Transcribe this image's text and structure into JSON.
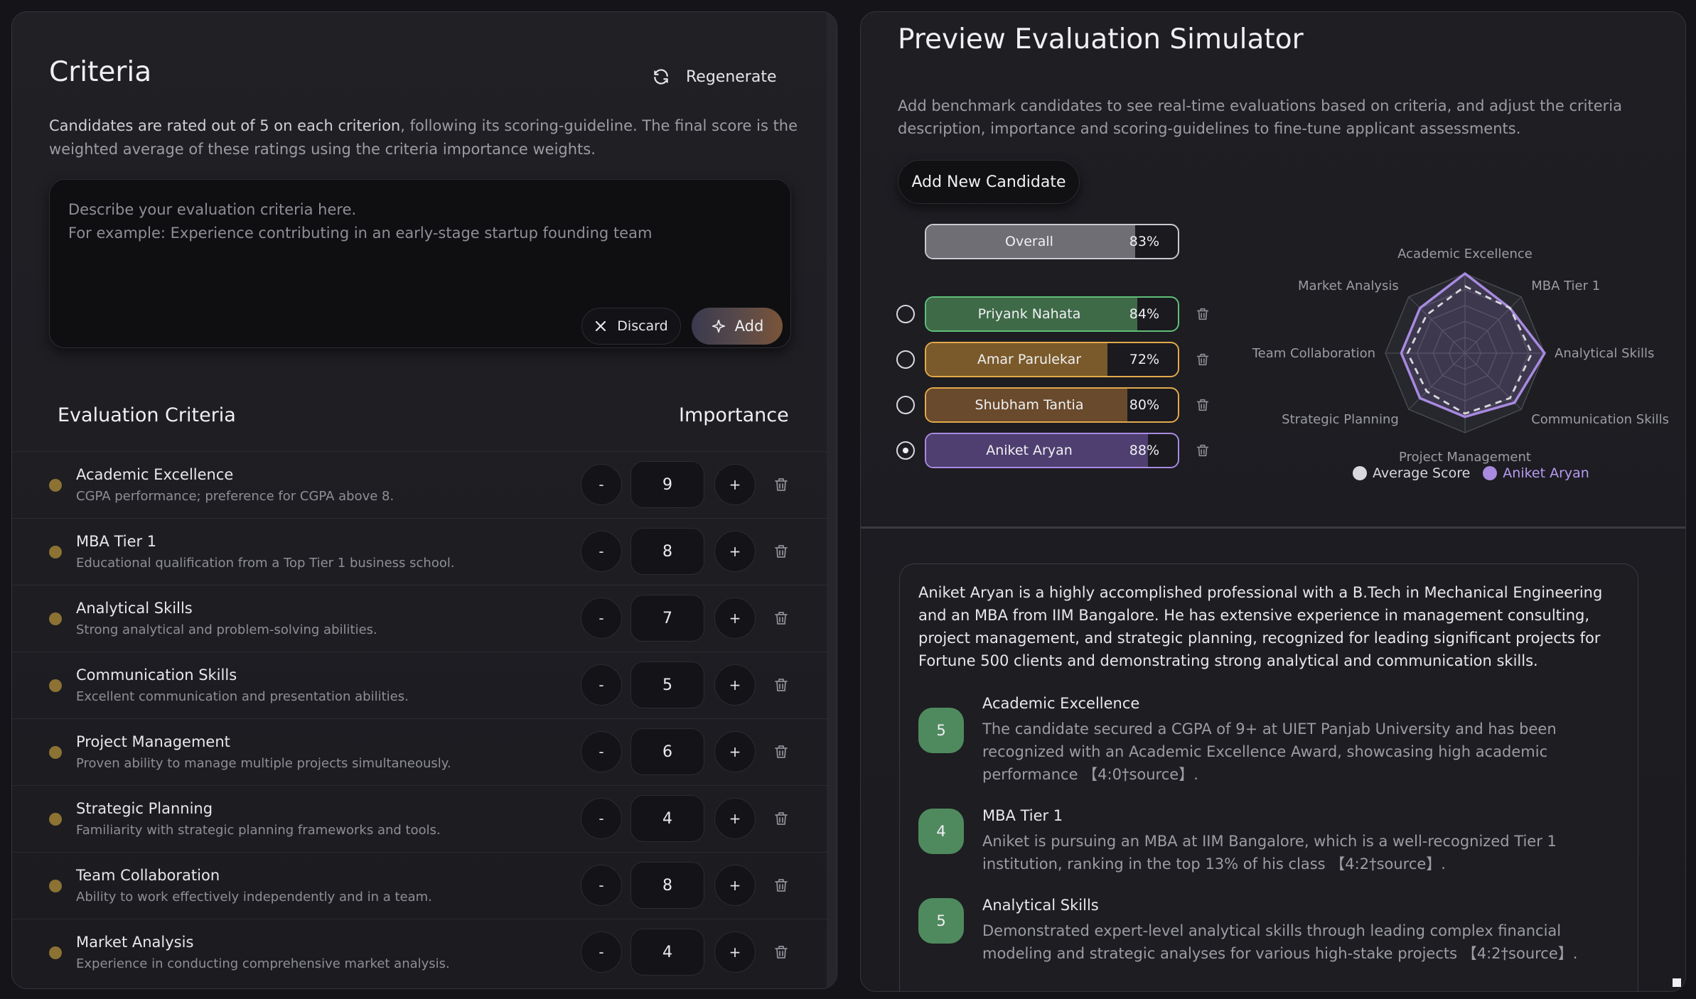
{
  "criteria_panel": {
    "title": "Criteria",
    "regenerate_label": "Regenerate",
    "intro_bold": "Candidates are rated out of 5 on each criterion",
    "intro_rest": ", following its scoring-guideline. The final score is the weighted average of these ratings using the criteria importance weights.",
    "editor_placeholder": "Describe your evaluation criteria here.\nFor example: Experience contributing in an early-stage startup founding team",
    "discard_label": "Discard",
    "add_label": "Add",
    "list_header": "Evaluation Criteria",
    "importance_header": "Importance",
    "minus_label": "-",
    "plus_label": "+",
    "items": [
      {
        "name": "Academic Excellence",
        "description": "CGPA performance; preference for CGPA above 8.",
        "importance": "9"
      },
      {
        "name": "MBA Tier 1",
        "description": "Educational qualification from a Top Tier 1 business school.",
        "importance": "8"
      },
      {
        "name": "Analytical Skills",
        "description": "Strong analytical and problem-solving abilities.",
        "importance": "7"
      },
      {
        "name": "Communication Skills",
        "description": "Excellent communication and presentation abilities.",
        "importance": "5"
      },
      {
        "name": "Project Management",
        "description": "Proven ability to manage multiple projects simultaneously.",
        "importance": "6"
      },
      {
        "name": "Strategic Planning",
        "description": "Familiarity with strategic planning frameworks and tools.",
        "importance": "4"
      },
      {
        "name": "Team Collaboration",
        "description": "Ability to work effectively independently and in a team.",
        "importance": "8"
      },
      {
        "name": "Market Analysis",
        "description": "Experience in conducting comprehensive market analysis.",
        "importance": "4"
      }
    ]
  },
  "simulator_panel": {
    "title": "Preview Evaluation Simulator",
    "intro": "Add benchmark candidates to see real-time evaluations based on criteria, and adjust the criteria description, importance and scoring-guidelines to fine-tune applicant assessments.",
    "add_candidate_label": "Add New Candidate",
    "overall": {
      "label": "Overall",
      "percent": "83%",
      "fraction": 0.83,
      "color": "#6e6e74",
      "border": "#c9c9cf"
    },
    "candidates": [
      {
        "name": "Priyank Nahata",
        "percent": "84%",
        "fraction": 0.84,
        "color": "#3f6a48",
        "border": "#5fbf78",
        "selected": false
      },
      {
        "name": "Amar Parulekar",
        "percent": "72%",
        "fraction": 0.72,
        "color": "#7a5a2a",
        "border": "#e3a94a",
        "selected": false
      },
      {
        "name": "Shubham Tantia",
        "percent": "80%",
        "fraction": 0.8,
        "color": "#6a4a2c",
        "border": "#e3a94a",
        "selected": false
      },
      {
        "name": "Aniket Aryan",
        "percent": "88%",
        "fraction": 0.88,
        "color": "#4e3f70",
        "border": "#a88ae0",
        "selected": true
      }
    ],
    "radar": {
      "axes": [
        "Academic Excellence",
        "MBA Tier 1",
        "Analytical Skills",
        "Communication Skills",
        "Project Management",
        "Strategic Planning",
        "Team Collaboration",
        "Market Analysis"
      ],
      "max": 5,
      "average_scores": [
        4.2,
        4.0,
        4.2,
        4.0,
        3.8,
        3.4,
        3.6,
        3.4
      ],
      "candidate_scores": [
        5,
        4,
        5,
        4.4,
        4.0,
        4.0,
        4.0,
        4.0
      ],
      "average_color": "#d8d8de",
      "candidate_color": "#a88ae0"
    },
    "legend": {
      "average_label": "Average Score",
      "candidate_label": "Aniket Aryan"
    },
    "summary": "Aniket Aryan is a highly accomplished professional with a B.Tech in Mechanical Engineering and an MBA from IIM Bangalore. He has extensive experience in management consulting, project management, and strategic planning, recognized for leading significant projects for Fortune 500 clients and demonstrating strong analytical and communication skills.",
    "scores": [
      {
        "criterion": "Academic Excellence",
        "score": "5",
        "text": "The candidate secured a CGPA of 9+ at UIET Panjab University and has been recognized with an Academic Excellence Award, showcasing high academic performance 【4:0†source】."
      },
      {
        "criterion": "MBA Tier 1",
        "score": "4",
        "text": "Aniket is pursuing an MBA at IIM Bangalore, which is a well-recognized Tier 1 institution, ranking in the top 13% of his class 【4:2†source】."
      },
      {
        "criterion": "Analytical Skills",
        "score": "5",
        "text": "Demonstrated expert-level analytical skills through leading complex financial modeling and strategic analyses for various high-stake projects 【4:2†source】."
      }
    ]
  }
}
